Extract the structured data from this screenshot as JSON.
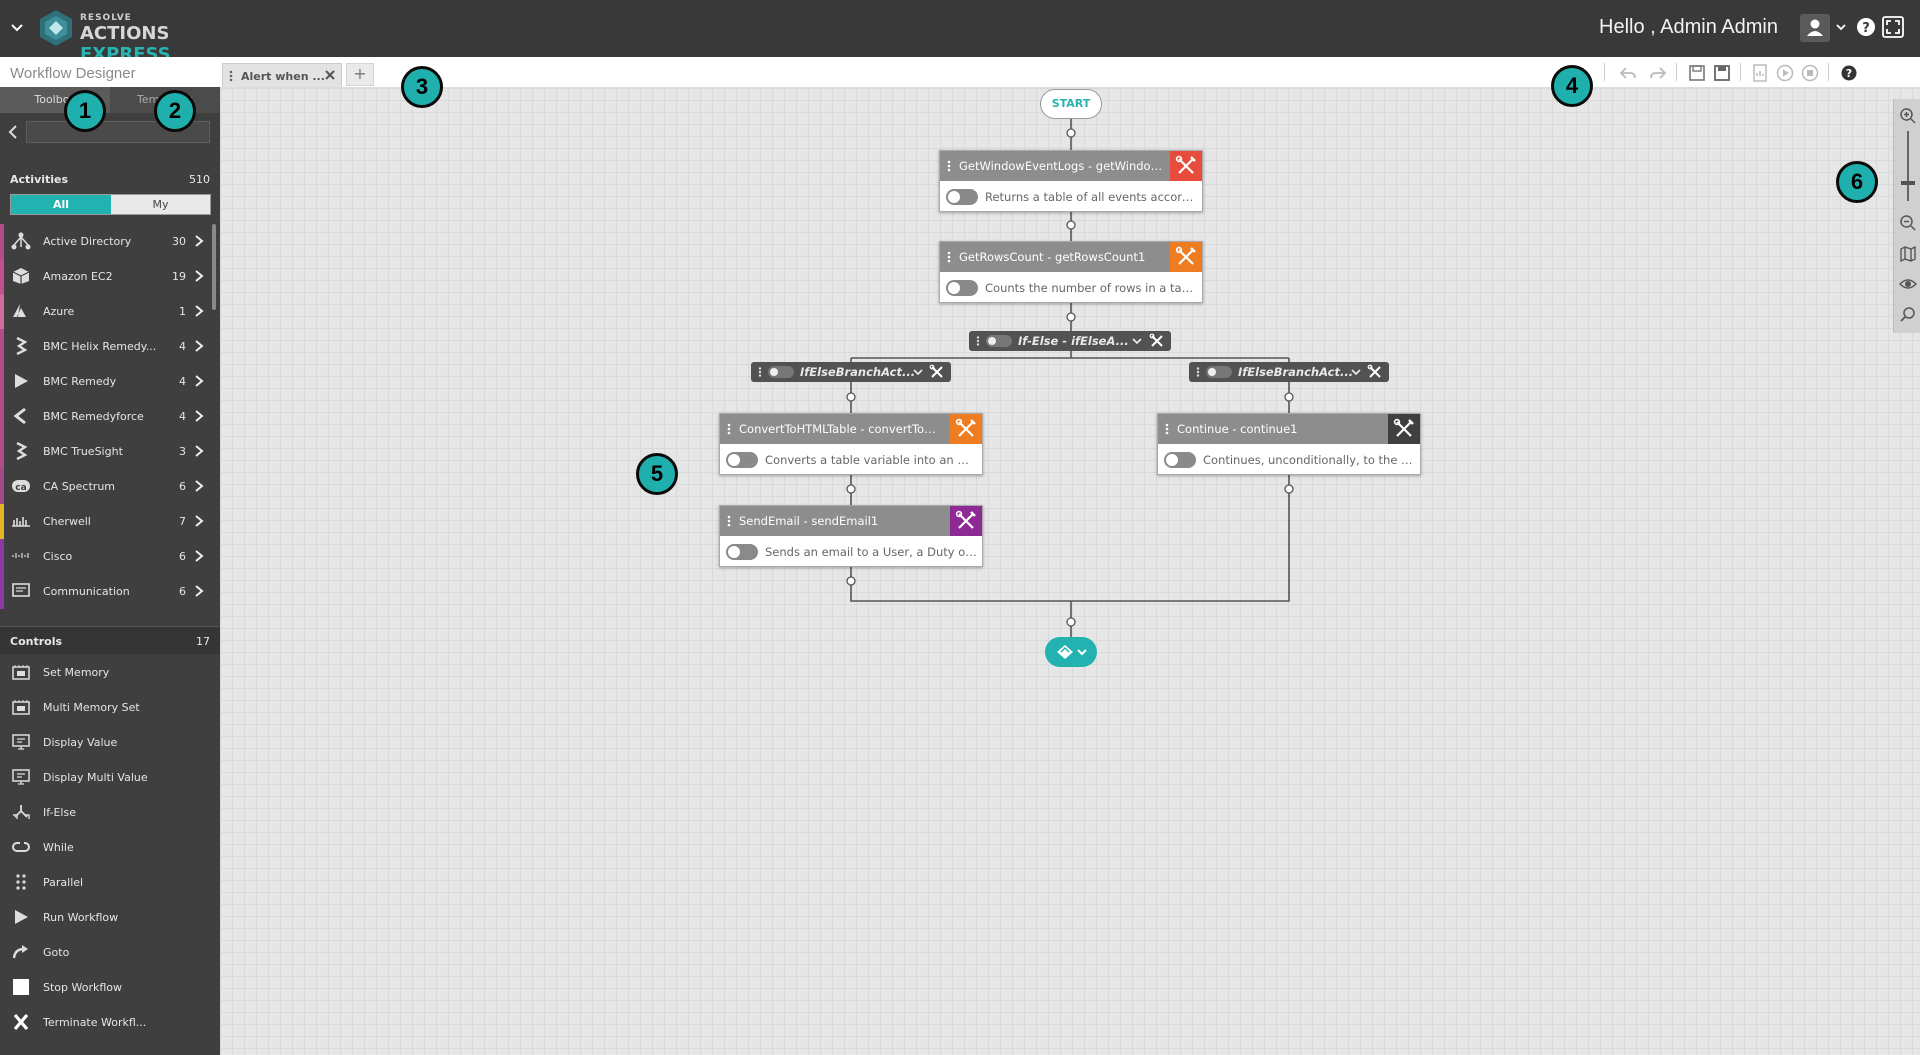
{
  "header": {
    "brand_top": "RESOLVE",
    "brand_bottom_a": "ACTIONS ",
    "brand_bottom_b": "EXPRESS",
    "greeting": "Hello , Admin Admin"
  },
  "sidebar": {
    "title": "Workflow Designer",
    "tabs": [
      "Toolbox",
      "Templates"
    ],
    "search_value": "",
    "activities": {
      "label": "Activities",
      "count": "510",
      "filter_all": "All",
      "filter_my": "My",
      "items": [
        {
          "label": "Active Directory",
          "count": "30",
          "color": "#b04b8c",
          "icon": "sitemap-icon"
        },
        {
          "label": "Amazon EC2",
          "count": "19",
          "color": "#c4508f",
          "icon": "cube-icon"
        },
        {
          "label": "Azure",
          "count": "1",
          "color": "#d06a9f",
          "icon": "azure-icon"
        },
        {
          "label": "BMC Helix Remedy...",
          "count": "4",
          "color": "#b04b8c",
          "icon": "bmc-icon"
        },
        {
          "label": "BMC Remedy",
          "count": "4",
          "color": "#b04b8c",
          "icon": "play-icon"
        },
        {
          "label": "BMC Remedyforce",
          "count": "4",
          "color": "#b04b8c",
          "icon": "share-icon"
        },
        {
          "label": "BMC TrueSight",
          "count": "3",
          "color": "#b04b8c",
          "icon": "bmc-icon"
        },
        {
          "label": "CA Spectrum",
          "count": "6",
          "color": "#a04a8a",
          "icon": "ca-icon"
        },
        {
          "label": "Cherwell",
          "count": "7",
          "color": "#e5b521",
          "icon": "cherwell-icon"
        },
        {
          "label": "Cisco",
          "count": "6",
          "color": "#8b3aa0",
          "icon": "cisco-icon"
        },
        {
          "label": "Communication",
          "count": "6",
          "color": "#8b3aa0",
          "icon": "message-icon"
        }
      ]
    },
    "controls": {
      "label": "Controls",
      "count": "17",
      "items": [
        {
          "label": "Set Memory",
          "icon": "memory-icon"
        },
        {
          "label": "Multi Memory Set",
          "icon": "memory-icon"
        },
        {
          "label": "Display Value",
          "icon": "display-icon"
        },
        {
          "label": "Display Multi Value",
          "icon": "display-icon"
        },
        {
          "label": "If-Else",
          "icon": "branch-icon"
        },
        {
          "label": "While",
          "icon": "loop-icon"
        },
        {
          "label": "Parallel",
          "icon": "parallel-icon"
        },
        {
          "label": "Run Workflow",
          "icon": "play-icon"
        },
        {
          "label": "Goto",
          "icon": "goto-icon"
        },
        {
          "label": "Stop Workflow",
          "icon": "stop-icon"
        },
        {
          "label": "Terminate Workfl...",
          "icon": "terminate-icon"
        }
      ]
    }
  },
  "tabs": {
    "active_label": "Alert when ...",
    "add_label": "+"
  },
  "canvas": {
    "start_label": "START",
    "nodes": [
      {
        "id": "n1",
        "title": "GetWindowEventLogs - getWindowE...",
        "desc": "Returns a table of all events according...",
        "accent": "#e84c3d"
      },
      {
        "id": "n2",
        "title": "GetRowsCount - getRowsCount1",
        "desc": "Counts the number of rows in a table",
        "accent": "#ee7d22"
      },
      {
        "id": "n3",
        "title": "ConvertToHTMLTable - convertToHT...",
        "desc": "Converts a table variable into an HTM...",
        "accent": "#ee7d22"
      },
      {
        "id": "n4",
        "title": "SendEmail - sendEmail1",
        "desc": "Sends an email to a User, a Duty or a ...",
        "accent": "#8d2a96"
      },
      {
        "id": "n5",
        "title": "Continue - continue1",
        "desc": "Continues, unconditionally, to the nex...",
        "accent": "#3f3f3f"
      }
    ],
    "ifelse_label": "If-Else - ifElseA...",
    "branch_left_label": "IfElseBranchAct...",
    "branch_right_label": "IfElseBranchAct..."
  },
  "callouts": [
    "1",
    "2",
    "3",
    "4",
    "5",
    "6"
  ],
  "colors": {
    "accent": "#22b2b0",
    "topbar": "#393939",
    "sidebar": "#3f3f3f"
  }
}
